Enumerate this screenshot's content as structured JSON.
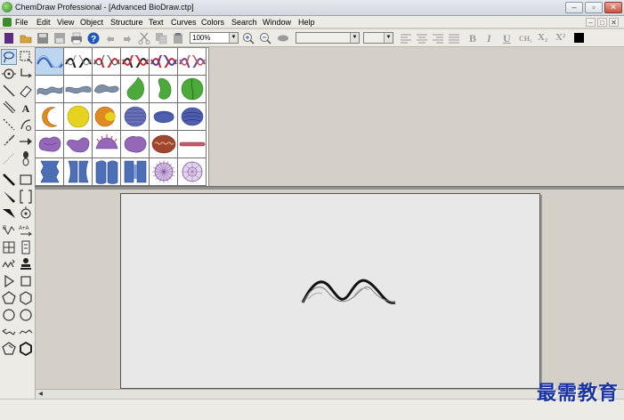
{
  "window": {
    "title": "ChemDraw Professional - [Advanced BioDraw.ctp]",
    "minimize_glyph": "–",
    "maximize_glyph": "▫",
    "close_glyph": "✕"
  },
  "menu": {
    "items": [
      "File",
      "Edit",
      "View",
      "Object",
      "Structure",
      "Text",
      "Curves",
      "Colors",
      "Search",
      "Window",
      "Help"
    ],
    "doc_controls": [
      "–",
      "□",
      "✕"
    ]
  },
  "toolbar": {
    "zoom_value": "100%",
    "font_value": "",
    "size_value": "",
    "format_labels": [
      "B",
      "I",
      "U",
      "CH₂",
      "X₂",
      "X²"
    ],
    "color_swatch": "#000000"
  },
  "templates": {
    "rows": [
      [
        "helix-blue-template",
        "helix-black-template",
        "helix-red-template",
        "helix-red-black-template",
        "helix-red-purple-template",
        "helix-purple-template"
      ],
      [
        "membrane-gray-template",
        "membrane-gray-flat-template",
        "membrane-gray-curled-template",
        "leaf-green-template",
        "leaf-green-curved-template",
        "leaf-green-split-template"
      ],
      [
        "cell-orange-crescent-template",
        "cell-yellow-round-template",
        "cell-orange-yellow-template",
        "organelle-purple-striped-template",
        "organelle-blue-template",
        "organelle-blue-layered-template"
      ],
      [
        "organelle-purple-blob-template",
        "organelle-purple-fold-template",
        "organelle-purple-spiky-template",
        "organelle-purple-ring-template",
        "mitochondrion-brown-template",
        "rod-red-template"
      ],
      [
        "channel-blue-template",
        "channel-blue-split-template",
        "channel-blue-double-template",
        "channel-blue-wide-template",
        "virus-purple-spiked-template",
        "virus-purple-ring-template"
      ]
    ]
  },
  "canvas": {
    "drawn_object": "dna-helix"
  },
  "watermark": "最需教育",
  "colors": {
    "chrome": "#d4d0c8",
    "panel": "#ecebe6",
    "selection": "#bcd6f2",
    "watermark": "#1a33a0"
  }
}
